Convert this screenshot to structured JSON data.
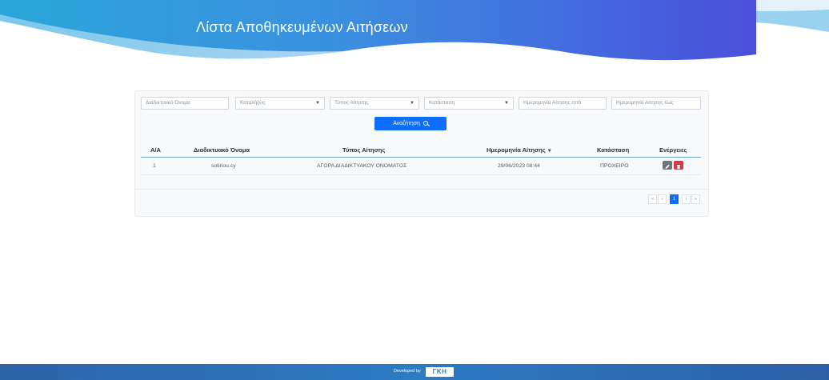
{
  "header": {
    "title": "Λίστα Αποθηκευμένων Αιτήσεων"
  },
  "filters": {
    "domain_name_placeholder": "Διαδικτυακό Όνομα",
    "extension_placeholder": "Καταλήξεις",
    "request_type_placeholder": "Τύπος Αίτησης",
    "status_placeholder": "Κατάσταση",
    "date_from_placeholder": "Ημερομηνία Αίτησης από",
    "date_to_placeholder": "Ημερομηνία Αίτησης έως",
    "search_label": "Αναζήτηση"
  },
  "table": {
    "headers": {
      "index": "Α/Α",
      "domain": "Διαδικτυακό Όνομα",
      "type": "Τύπος Αίτησης",
      "date": "Ημερομηνία Αίτησης",
      "status": "Κατάσταση",
      "actions": "Ενέργειες"
    },
    "rows": [
      {
        "index": "1",
        "domain": "sotiriou.cy",
        "type": "ΑΓΟΡΑ ΔΙΑΔΙΚΤΥΑΚΟΥ ΟΝΟΜΑΤΟΣ",
        "date": "29/06/2023 08:44",
        "status": "ΠΡΟΧΕΙΡΟ"
      }
    ]
  },
  "pagination": {
    "first": "«",
    "prev": "‹",
    "current": "1",
    "next": "›",
    "last": "»"
  },
  "footer": {
    "developed_by": "Developed by",
    "logo_text": "ΓΚΗ"
  },
  "colors": {
    "primary": "#0d6efd",
    "danger": "#dc3545",
    "secondary": "#6c757d",
    "banner_start": "#2a9fd6",
    "banner_end": "#4a4fdc",
    "footer": "#2b7cc4"
  },
  "icons": [
    "search-icon",
    "chevron-down-icon",
    "sort-desc-icon",
    "pencil-icon",
    "trash-icon"
  ]
}
